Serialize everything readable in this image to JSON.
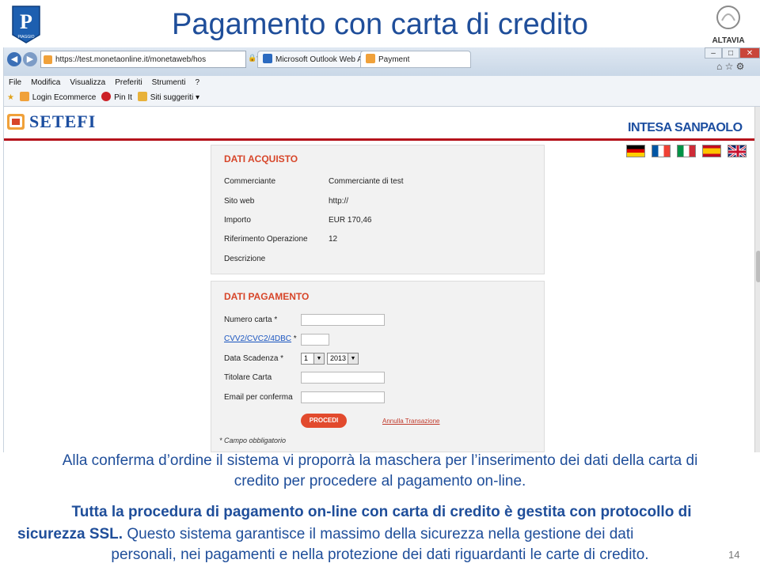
{
  "slide": {
    "title": "Pagamento con carta di credito",
    "piaggio_logo_text": "PIAGGIO",
    "altavia_logo_text": "ALTAVIA",
    "text_line1": "Alla conferma d’ordine il sistema vi proporrà la maschera per l’inserimento dei dati della carta di",
    "text_line2": "credito per procedere al pagamento on-line.",
    "bold_line1": "Tutta la procedura di pagamento on-line con carta di credito è gestita con protocollo di",
    "bold_line2": "sicurezza SSL.",
    "text_line3": "Questo sistema garantisce il massimo della sicurezza nella gestione dei dati",
    "text_line4": "personali, nei pagamenti e nella protezione dei dati riguardanti le carte di credito.",
    "page_number": "14"
  },
  "browser": {
    "url": "https://test.monetaonline.it/monetaweb/hos",
    "tabs": [
      {
        "label": "Microsoft Outlook Web Access"
      },
      {
        "label": "Payment"
      }
    ],
    "menu": [
      "File",
      "Modifica",
      "Visualizza",
      "Preferiti",
      "Strumenti",
      "?"
    ],
    "favorites": [
      "Login Ecommerce",
      "Pin It",
      "Siti suggeriti"
    ]
  },
  "page": {
    "brand_left": "SETEFI",
    "brand_right": "INTESA SANPAOLO",
    "flags": [
      "flag-de-icon",
      "flag-fr-icon",
      "flag-it-icon",
      "flag-es-icon",
      "flag-uk-icon"
    ],
    "dati_acquisto": {
      "title": "DATI ACQUISTO",
      "rows": [
        {
          "label": "Commerciante",
          "value": "Commerciante di test"
        },
        {
          "label": "Sito web",
          "value": "http://"
        },
        {
          "label": "Importo",
          "value": "EUR 170,46"
        },
        {
          "label": "Riferimento Operazione",
          "value": "12"
        },
        {
          "label": "Descrizione",
          "value": ""
        }
      ]
    },
    "dati_pagamento": {
      "title": "DATI PAGAMENTO",
      "numero_carta": "Numero carta *",
      "cvv_link": "CVV2/CVC2/4DBC",
      "cvv_star": " *",
      "data_scadenza": "Data Scadenza *",
      "month": "1",
      "year": "2013",
      "titolare": "Titolare Carta",
      "email": "Email per conferma",
      "procedi": "PROCEDI",
      "annulla": "Annulla Transazione",
      "campo_obbligatorio": "* Campo obbligatorio"
    }
  },
  "colors": {
    "slide_blue": "#1f4e9a",
    "accent_red": "#d7462a"
  }
}
